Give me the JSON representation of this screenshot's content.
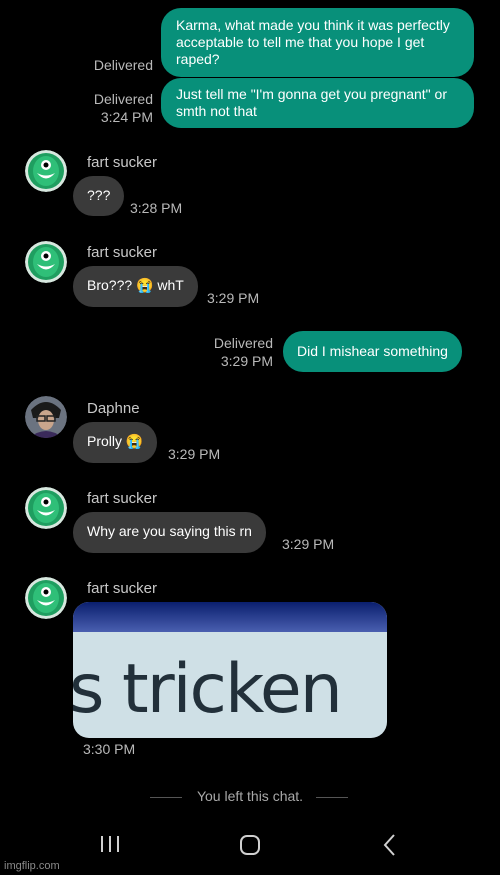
{
  "messages": {
    "m1": {
      "text": "Karma, what made you think it was perfectly acceptable to tell me that you hope I get raped?",
      "status": "Delivered"
    },
    "m2": {
      "text": "Just tell me \"I'm gonna get you pregnant\" or smth not that",
      "status": "Delivered",
      "time": "3:24 PM"
    },
    "m3": {
      "sender": "fart sucker",
      "text": "???",
      "time": "3:28 PM"
    },
    "m4": {
      "sender": "fart sucker",
      "text": "Bro??? 😭 whT",
      "time": "3:29 PM"
    },
    "m5": {
      "text": "Did I mishear something",
      "status": "Delivered",
      "time": "3:29 PM"
    },
    "m6": {
      "sender": "Daphne",
      "text": "Prolly 😭",
      "time": "3:29 PM"
    },
    "m7": {
      "sender": "fart sucker",
      "text": "Why are you saying this rn",
      "time": "3:29 PM"
    },
    "m8": {
      "sender": "fart sucker",
      "image_text": "s tricken",
      "time": "3:30 PM"
    }
  },
  "system_message": "You left this chat.",
  "nav": {
    "recents": "recents-icon",
    "home": "home-icon",
    "back": "back-icon"
  },
  "watermark": "imgflip.com",
  "colors": {
    "outgoing": "#08907a",
    "incoming": "#3a3a3a",
    "background": "#000000"
  }
}
